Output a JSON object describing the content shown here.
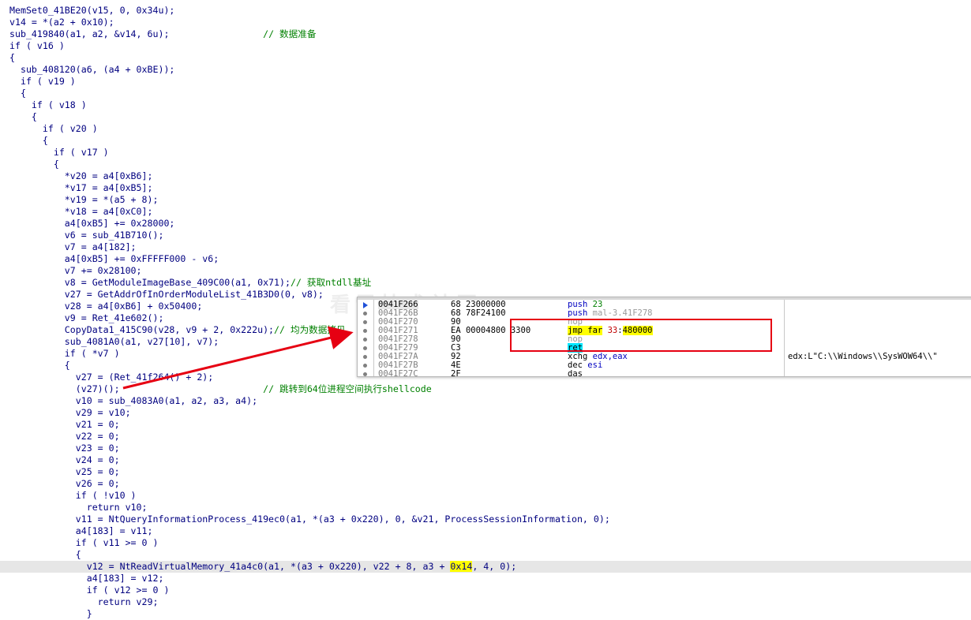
{
  "code_lines": [
    {
      "text": "MemSet0_41BE20(v15, 0, 0x34u);",
      "comment": ""
    },
    {
      "text": "v14 = *(a2 + 0x10);",
      "comment": ""
    },
    {
      "text": "sub_419840(a1, a2, &v14, 6u);                 ",
      "comment": "// 数据准备"
    },
    {
      "text": "if ( v16 )",
      "comment": ""
    },
    {
      "text": "{",
      "comment": ""
    },
    {
      "text": "  sub_408120(a6, (a4 + 0xBE));",
      "comment": ""
    },
    {
      "text": "  if ( v19 )",
      "comment": ""
    },
    {
      "text": "  {",
      "comment": ""
    },
    {
      "text": "    if ( v18 )",
      "comment": ""
    },
    {
      "text": "    {",
      "comment": ""
    },
    {
      "text": "      if ( v20 )",
      "comment": ""
    },
    {
      "text": "      {",
      "comment": ""
    },
    {
      "text": "        if ( v17 )",
      "comment": ""
    },
    {
      "text": "        {",
      "comment": ""
    },
    {
      "text": "          *v20 = a4[0xB6];",
      "comment": ""
    },
    {
      "text": "          *v17 = a4[0xB5];",
      "comment": ""
    },
    {
      "text": "          *v19 = *(a5 + 8);",
      "comment": ""
    },
    {
      "text": "          *v18 = a4[0xC0];",
      "comment": ""
    },
    {
      "text": "          a4[0xB5] += 0x28000;",
      "comment": ""
    },
    {
      "text": "          v6 = sub_41B710();",
      "comment": ""
    },
    {
      "text": "          v7 = a4[182];",
      "comment": ""
    },
    {
      "text": "          a4[0xB5] += 0xFFFFF000 - v6;",
      "comment": ""
    },
    {
      "text": "          v7 += 0x28100;",
      "comment": ""
    },
    {
      "text": "          v8 = GetModuleImageBase_409C00(a1, 0x71);",
      "comment": "// 获取ntdll基址"
    },
    {
      "text": "          v27 = GetAddrOfInOrderModuleList_41B3D0(0, v8);",
      "comment": ""
    },
    {
      "text": "          v28 = a4[0xB6] + 0x50400;",
      "comment": ""
    },
    {
      "text": "          v9 = Ret_41e602();",
      "comment": ""
    },
    {
      "text": "          CopyData1_415C90(v28, v9 + 2, 0x222u);",
      "comment": "// 均为数据拷贝"
    },
    {
      "text": "          sub_4081A0(a1, v27[10], v7);",
      "comment": ""
    },
    {
      "text": "          if ( *v7 )",
      "comment": ""
    },
    {
      "text": "          {",
      "comment": ""
    },
    {
      "text": "            v27 = (Ret_41f264() + 2);",
      "comment": ""
    },
    {
      "text": "            (v27)();                          ",
      "comment": "// 跳转到64位进程空间执行shellcode"
    },
    {
      "text": "            v10 = sub_4083A0(a1, a2, a3, a4);",
      "comment": ""
    },
    {
      "text": "            v29 = v10;",
      "comment": ""
    },
    {
      "text": "            v21 = 0;",
      "comment": ""
    },
    {
      "text": "            v22 = 0;",
      "comment": ""
    },
    {
      "text": "            v23 = 0;",
      "comment": ""
    },
    {
      "text": "            v24 = 0;",
      "comment": ""
    },
    {
      "text": "            v25 = 0;",
      "comment": ""
    },
    {
      "text": "            v26 = 0;",
      "comment": ""
    },
    {
      "text": "            if ( !v10 )",
      "comment": ""
    },
    {
      "text": "              return v10;",
      "comment": ""
    },
    {
      "text": "            v11 = NtQueryInformationProcess_419ec0(a1, *(a3 + 0x220), 0, &v21, ProcessSessionInformation, 0);",
      "comment": ""
    },
    {
      "text": "            a4[183] = v11;",
      "comment": ""
    },
    {
      "text": "            if ( v11 >= 0 )",
      "comment": ""
    },
    {
      "text": "            {",
      "comment": ""
    },
    {
      "text": "              v12 = NtReadVirtualMemory_41a4c0(a1, *(a3 + 0x220), v22 + 8, a3 + ",
      "comment": "",
      "highlight": "0x14",
      "tail": ", 4, 0);"
    },
    {
      "text": "              a4[183] = v12;",
      "comment": ""
    },
    {
      "text": "              if ( v12 >= 0 )",
      "comment": ""
    },
    {
      "text": "                return v29;",
      "comment": ""
    },
    {
      "text": "              }",
      "comment": ""
    }
  ],
  "disasm": [
    {
      "addr": "0041F266",
      "bytes": "68 23000000",
      "mnemonic": "push",
      "operand": "23",
      "comment": ""
    },
    {
      "addr": "0041F26B",
      "bytes": "68 78F24100",
      "mnemonic": "push",
      "operand": "mal-3.41F278",
      "comment": ""
    },
    {
      "addr": "0041F270",
      "bytes": "90",
      "mnemonic": "nop",
      "operand": "",
      "comment": ""
    },
    {
      "addr": "0041F271",
      "bytes": "EA 00004800 3300",
      "mnemonic": "jmp far",
      "operand": "33:480000",
      "comment": ""
    },
    {
      "addr": "0041F278",
      "bytes": "90",
      "mnemonic": "nop",
      "operand": "",
      "comment": ""
    },
    {
      "addr": "0041F279",
      "bytes": "C3",
      "mnemonic": "ret",
      "operand": "",
      "comment": ""
    },
    {
      "addr": "0041F27A",
      "bytes": "92",
      "mnemonic": "xchg",
      "operand": "edx,eax",
      "comment": "edx:L\"C:\\\\Windows\\\\SysWOW64\\\\\""
    },
    {
      "addr": "0041F27B",
      "bytes": "4E",
      "mnemonic": "dec",
      "operand": "esi",
      "comment": ""
    },
    {
      "addr": "0041F27C",
      "bytes": "2F",
      "mnemonic": "das",
      "operand": "",
      "comment": ""
    }
  ],
  "watermark": "看雪技术社区",
  "colors": {
    "highlight": "#ffff00",
    "ret_highlight": "#00e5ff",
    "annotation": "#e60012",
    "comment": "#008000"
  }
}
